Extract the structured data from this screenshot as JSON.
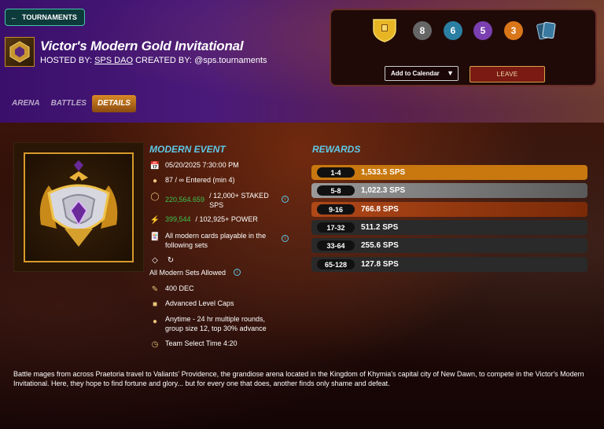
{
  "header": {
    "back_label": "TOURNAMENTS",
    "title": "Victor's Modern Gold Invitational",
    "hosted_prefix": "HOSTED BY:",
    "hosted_by": "SPS DAO",
    "created_prefix": "CREATED BY:",
    "created_by": "@sps.tournaments"
  },
  "tabs": [
    {
      "label": "ARENA"
    },
    {
      "label": "BATTLES"
    },
    {
      "label": "DETAILS",
      "active": true
    }
  ],
  "panel": {
    "badges": [
      {
        "value": "8",
        "color": "#666666"
      },
      {
        "value": "6",
        "color": "#2b7fa3"
      },
      {
        "value": "5",
        "color": "#7a3fb0"
      },
      {
        "value": "3",
        "color": "#d9761a"
      }
    ],
    "calendar_select": "Add to Calendar",
    "leave_label": "LEAVE"
  },
  "event": {
    "title": "MODERN EVENT",
    "datetime": "05/20/2025 7:30:00 PM",
    "entered": "87 / ∞ Entered (min 4)",
    "staked_value": "220,564.659",
    "staked_text": "/ 12,000+ STAKED",
    "staked_unit": "SPS",
    "power_value": "399,544",
    "power_text": "/ 102,925+ POWER",
    "cards_line1": "All modern cards playable in the",
    "cards_line2": "following sets",
    "sets_allowed": "All Modern Sets Allowed",
    "entry_fee": "400 DEC",
    "level_caps": "Advanced Level Caps",
    "rounds_line1": "Anytime - 24 hr multiple rounds,",
    "rounds_line2": "group size 12, top 30% advance",
    "team_select": "Team Select Time 4:20"
  },
  "rewards": {
    "title": "REWARDS",
    "items": [
      {
        "range": "1-4",
        "amount": "1,533.5 SPS",
        "color": "#c8780f"
      },
      {
        "range": "5-8",
        "amount": "1,022.3 SPS",
        "color": "#8a8a8a"
      },
      {
        "range": "9-16",
        "amount": "766.8 SPS",
        "color": "#9a3a10"
      },
      {
        "range": "17-32",
        "amount": "511.2 SPS",
        "color": "#2a2a2a"
      },
      {
        "range": "33-64",
        "amount": "255.6 SPS",
        "color": "#2a2a2a"
      },
      {
        "range": "65-128",
        "amount": "127.8 SPS",
        "color": "#2a2a2a"
      }
    ]
  },
  "description": "Battle mages from across Praetoria travel to Valiants' Providence, the grandiose arena located in the Kingdom of Khymia's capital city of New Dawn, to compete in the Victor's Modern Invitational. Here, they hope to find fortune and glory... but for every one that does, another finds only shame and defeat."
}
